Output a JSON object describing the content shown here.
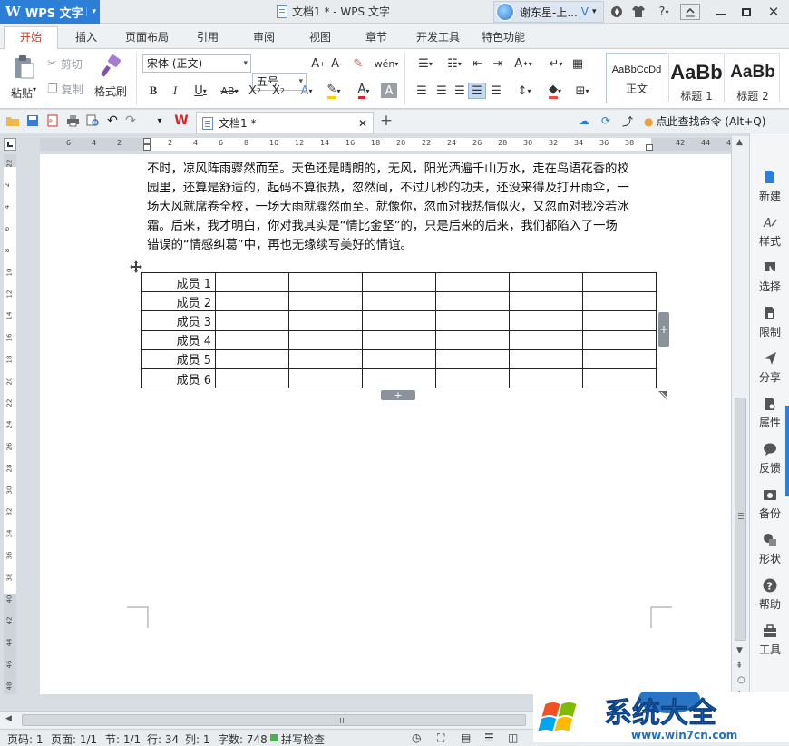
{
  "titlebar": {
    "app_menu": "WPS 文字",
    "doc_title": "文档1 * - WPS 文字",
    "user": "谢东星-上...",
    "help": "?"
  },
  "tabs": [
    "开始",
    "插入",
    "页面布局",
    "引用",
    "审阅",
    "视图",
    "章节",
    "开发工具",
    "特色功能"
  ],
  "toolbar": {
    "paste": "粘贴",
    "cut": "剪切",
    "copy": "复制",
    "format_painter": "格式刷",
    "font_name": "宋体 (正文)",
    "font_size": "五号",
    "styles": [
      {
        "sample": "AaBbCcDd",
        "name": "正文"
      },
      {
        "sample": "AaBb",
        "name": "标题 1"
      },
      {
        "sample": "AaBb",
        "name": "标题 2"
      }
    ]
  },
  "quick_access": {
    "doc_tab": "文档1 *",
    "search": "点此查找命令 (Alt+Q)"
  },
  "ruler": {
    "h": [
      "6",
      "4",
      "2",
      "",
      "2",
      "4",
      "6",
      "8",
      "10",
      "12",
      "14",
      "16",
      "18",
      "20",
      "22",
      "24",
      "26",
      "28",
      "30",
      "32",
      "34",
      "36",
      "38",
      "",
      "42",
      "44",
      "4"
    ],
    "v": [
      "22",
      "2",
      "4",
      "6",
      "8",
      "10",
      "12",
      "14",
      "16",
      "18",
      "20",
      "22",
      "24",
      "26",
      "28",
      "30",
      "32",
      "34",
      "36",
      "38",
      "40",
      "42",
      "44",
      "46",
      "48"
    ]
  },
  "document": {
    "paragraph": [
      "不时，凉风阵雨骤然而至。天色还是晴朗的，无风，阳光洒遍千山万水，走在鸟语花香的校",
      "园里，还算是舒适的，起码不算很热，忽然间，不过几秒的功夫，还没来得及打开雨伞，一",
      "场大风就席卷全校，一场大雨就骤然而至。就像你，忽而对我热情似火，又忽而对我冷若冰",
      "霜。后来，我才明白，你对我其实是“情比金坚”的，只是后来的后来，我们都陷入了一场",
      "错误的“情感纠葛”中，再也无缘续写美好的情谊。"
    ],
    "table_rows": [
      "成员 1",
      "成员 2",
      "成员 3",
      "成员 4",
      "成员 5",
      "成员 6"
    ]
  },
  "pane": [
    "新建",
    "样式",
    "选择",
    "限制",
    "分享",
    "属性",
    "反馈",
    "备份",
    "形状",
    "帮助",
    "工具"
  ],
  "status": {
    "page": "页码: 1",
    "pages": "页面: 1/1",
    "section": "节: 1/1",
    "line": "行: 34",
    "col": "列: 1",
    "words": "字数: 748",
    "spell": "拼写检查"
  },
  "watermark": {
    "text": "系统大全",
    "url": "www.win7cn.com"
  },
  "colors": {
    "accent": "#2c7ed6",
    "active_tab": "#c0392b"
  }
}
